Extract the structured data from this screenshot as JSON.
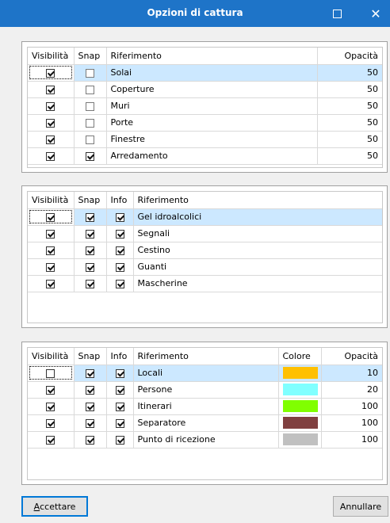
{
  "window": {
    "title": "Opzioni di cattura",
    "maximize_icon": "maximize-icon",
    "close_icon": "close-icon",
    "close_glyph": "✕"
  },
  "panels": [
    {
      "columns": [
        "Visibilità",
        "Snap",
        "Riferimento",
        "Opacità"
      ],
      "rows": [
        {
          "visibility": true,
          "snap": false,
          "reference": "Solai",
          "opacity": "50",
          "selected": true
        },
        {
          "visibility": true,
          "snap": false,
          "reference": "Coperture",
          "opacity": "50"
        },
        {
          "visibility": true,
          "snap": false,
          "reference": "Muri",
          "opacity": "50"
        },
        {
          "visibility": true,
          "snap": false,
          "reference": "Porte",
          "opacity": "50"
        },
        {
          "visibility": true,
          "snap": false,
          "reference": "Finestre",
          "opacity": "50"
        },
        {
          "visibility": true,
          "snap": true,
          "reference": "Arredamento",
          "opacity": "50"
        }
      ]
    },
    {
      "columns": [
        "Visibilità",
        "Snap",
        "Info",
        "Riferimento"
      ],
      "rows": [
        {
          "visibility": true,
          "snap": true,
          "info": true,
          "reference": "Gel idroalcolici",
          "selected": true
        },
        {
          "visibility": true,
          "snap": true,
          "info": true,
          "reference": "Segnali"
        },
        {
          "visibility": true,
          "snap": true,
          "info": true,
          "reference": "Cestino"
        },
        {
          "visibility": true,
          "snap": true,
          "info": true,
          "reference": "Guanti"
        },
        {
          "visibility": true,
          "snap": true,
          "info": true,
          "reference": "Mascherine"
        }
      ]
    },
    {
      "columns": [
        "Visibilità",
        "Snap",
        "Info",
        "Riferimento",
        "Colore",
        "Opacità"
      ],
      "rows": [
        {
          "visibility": false,
          "snap": true,
          "info": true,
          "reference": "Locali",
          "color": "#ffc000",
          "opacity": "10",
          "selected": true
        },
        {
          "visibility": true,
          "snap": true,
          "info": true,
          "reference": "Persone",
          "color": "#80ffff",
          "opacity": "20"
        },
        {
          "visibility": true,
          "snap": true,
          "info": true,
          "reference": "Itinerari",
          "color": "#80ff00",
          "opacity": "100"
        },
        {
          "visibility": true,
          "snap": true,
          "info": true,
          "reference": "Separatore",
          "color": "#804040",
          "opacity": "100"
        },
        {
          "visibility": true,
          "snap": true,
          "info": true,
          "reference": "Punto di ricezione",
          "color": "#c0c0c0",
          "opacity": "100"
        }
      ]
    }
  ],
  "buttons": {
    "accept_first": "A",
    "accept_rest": "ccettare",
    "cancel": "Annullare"
  }
}
